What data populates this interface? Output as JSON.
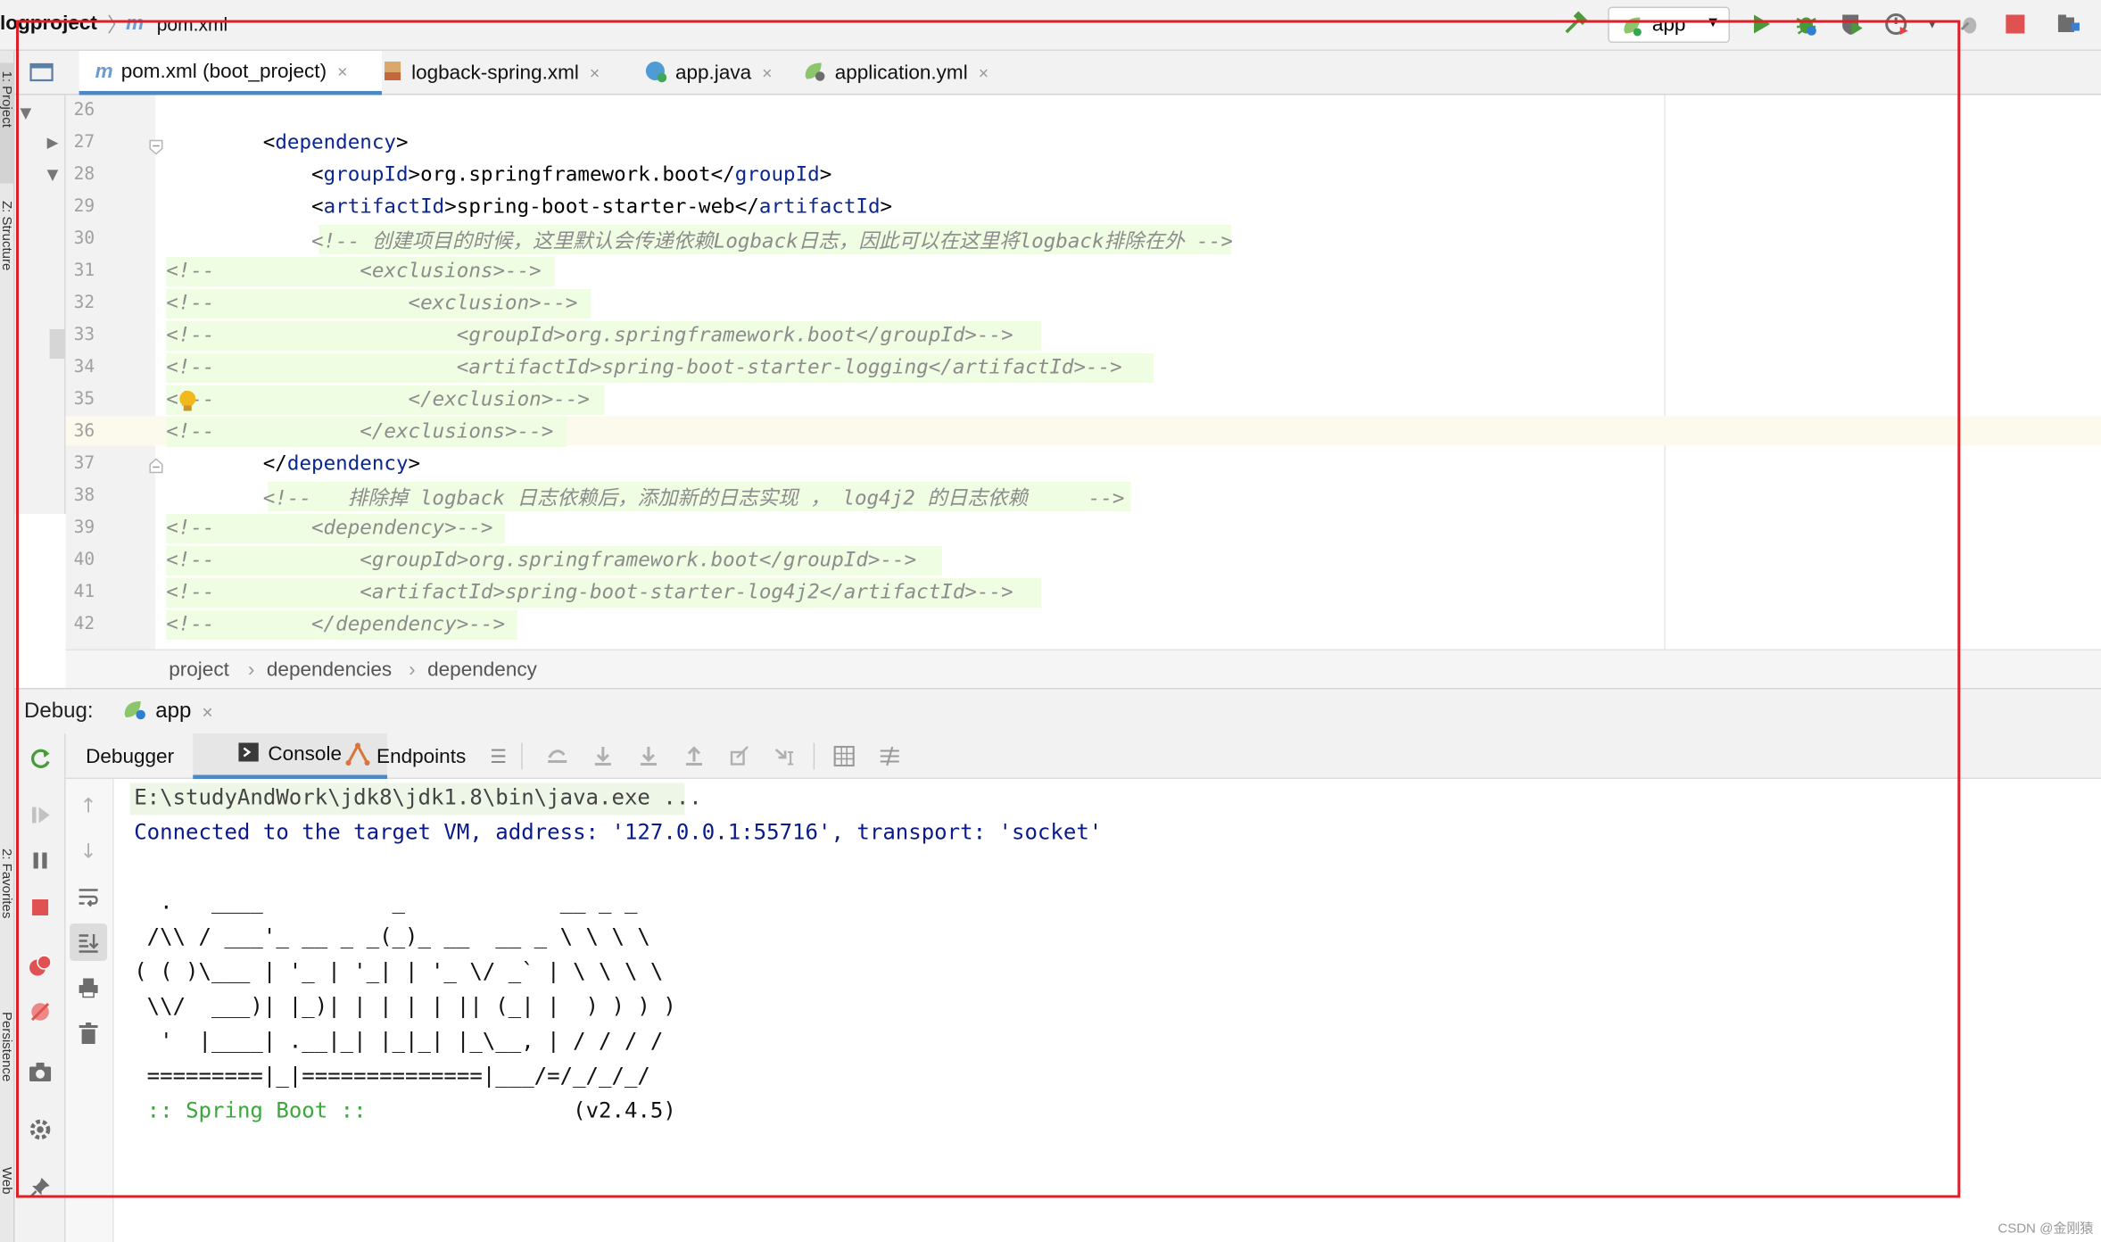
{
  "topbar": {
    "project": "logproject",
    "separator": "〉",
    "file_icon": "m",
    "file": "pom.xml",
    "run_config": "app"
  },
  "left_stripe": {
    "labels": [
      "1: Project",
      "Z: Structure",
      "2: Favorites",
      "Persistence",
      "Web"
    ]
  },
  "tabs": [
    {
      "icon": "m",
      "label": "pom.xml (boot_project)",
      "close": "×"
    },
    {
      "icon": "xml",
      "label": "logback-spring.xml",
      "close": "×"
    },
    {
      "icon": "c",
      "label": "app.java",
      "close": "×"
    },
    {
      "icon": "yml",
      "label": "application.yml",
      "close": "×"
    }
  ],
  "editor": {
    "lines": [
      {
        "n": "26",
        "segments": []
      },
      {
        "n": "27",
        "segments": [
          {
            "t": "        <",
            "c": "p"
          },
          {
            "t": "dependency",
            "c": "t"
          },
          {
            "t": ">",
            "c": "p"
          }
        ]
      },
      {
        "n": "28",
        "segments": [
          {
            "t": "            <",
            "c": "p"
          },
          {
            "t": "groupId",
            "c": "t"
          },
          {
            "t": ">org.springframework.boot</",
            "c": "p"
          },
          {
            "t": "groupId",
            "c": "t"
          },
          {
            "t": ">",
            "c": "p"
          }
        ]
      },
      {
        "n": "29",
        "segments": [
          {
            "t": "            <",
            "c": "p"
          },
          {
            "t": "artifactId",
            "c": "t"
          },
          {
            "t": ">spring-boot-starter-web</",
            "c": "p"
          },
          {
            "t": "artifactId",
            "c": "t"
          },
          {
            "t": ">",
            "c": "p"
          }
        ]
      },
      {
        "n": "30",
        "segments": [
          {
            "t": "            <!-- 创建项目的时候，这里默认会传递依赖Logback日志，因此可以在这里将logback排除在外 -->",
            "c": "cm"
          }
        ]
      },
      {
        "n": "31",
        "segments": [
          {
            "t": "<!--            <exclusions>-->",
            "c": "cm"
          }
        ]
      },
      {
        "n": "32",
        "segments": [
          {
            "t": "<!--                <exclusion>-->",
            "c": "cm"
          }
        ]
      },
      {
        "n": "33",
        "segments": [
          {
            "t": "<!--                    <groupId>org.springframework.boot</groupId>-->",
            "c": "cm"
          }
        ]
      },
      {
        "n": "34",
        "segments": [
          {
            "t": "<!--                    <artifactId>spring-boot-starter-logging</artifactId>-->",
            "c": "cm"
          }
        ]
      },
      {
        "n": "35",
        "segments": [
          {
            "t": "<!--                </exclusion>-->",
            "c": "cm"
          }
        ]
      },
      {
        "n": "36",
        "segments": [
          {
            "t": "<!--            </exclusions>-->",
            "c": "cm"
          }
        ]
      },
      {
        "n": "37",
        "segments": [
          {
            "t": "        </",
            "c": "p"
          },
          {
            "t": "dependency",
            "c": "t"
          },
          {
            "t": ">",
            "c": "p"
          }
        ]
      },
      {
        "n": "38",
        "segments": [
          {
            "t": "        <!--   排除掉 logback 日志依赖后，添加新的日志实现 ， log4j2 的日志依赖     -->",
            "c": "cm"
          }
        ]
      },
      {
        "n": "39",
        "segments": [
          {
            "t": "<!--        <dependency>-->",
            "c": "cm"
          }
        ]
      },
      {
        "n": "40",
        "segments": [
          {
            "t": "<!--            <groupId>org.springframework.boot</groupId>-->",
            "c": "cm"
          }
        ]
      },
      {
        "n": "41",
        "segments": [
          {
            "t": "<!--            <artifactId>spring-boot-starter-log4j2</artifactId>-->",
            "c": "cm"
          }
        ]
      },
      {
        "n": "42",
        "segments": [
          {
            "t": "<!--        </dependency>-->",
            "c": "cm"
          }
        ]
      }
    ]
  },
  "breadcrumb": [
    "project",
    "dependencies",
    "dependency"
  ],
  "breadcrumb_sep": "›",
  "debug": {
    "label": "Debug:",
    "tab": "app",
    "tab_close": "×",
    "tabs": [
      "Debugger",
      "Console",
      "Endpoints"
    ]
  },
  "console": {
    "lines": [
      {
        "text": "E:\\studyAndWork\\jdk8\\jdk1.8\\bin\\java.exe ...",
        "color": "#444444"
      },
      {
        "text": "Connected to the target VM, address: '127.0.0.1:55716', transport: 'socket'",
        "color": "#0a1a8c"
      },
      {
        "text": "",
        "color": "#111111"
      },
      {
        "text": "  .   ____          _            __ _ _",
        "color": "#111111"
      },
      {
        "text": " /\\\\ / ___'_ __ _ _(_)_ __  __ _ \\ \\ \\ \\",
        "color": "#111111"
      },
      {
        "text": "( ( )\\___ | '_ | '_| | '_ \\/ _` | \\ \\ \\ \\",
        "color": "#111111"
      },
      {
        "text": " \\\\/  ___)| |_)| | | | | || (_| |  ) ) ) )",
        "color": "#111111"
      },
      {
        "text": "  '  |____| .__|_| |_|_| |_\\__, | / / / /",
        "color": "#111111"
      },
      {
        "text": " =========|_|==============|___/=/_/_/_/",
        "color": "#111111"
      },
      {
        "text": " :: Spring Boot ::                (v2.4.5)",
        "color": "#111111"
      }
    ],
    "spring_label": ":: Spring Boot ::",
    "version": "(v2.4.5)"
  },
  "watermark": "CSDN @金刚猿",
  "colors": {
    "accent": "#4a88c7",
    "annotation": "#e01e28",
    "comment_bg": "#effde3",
    "spring_green": "#3aa83a"
  }
}
